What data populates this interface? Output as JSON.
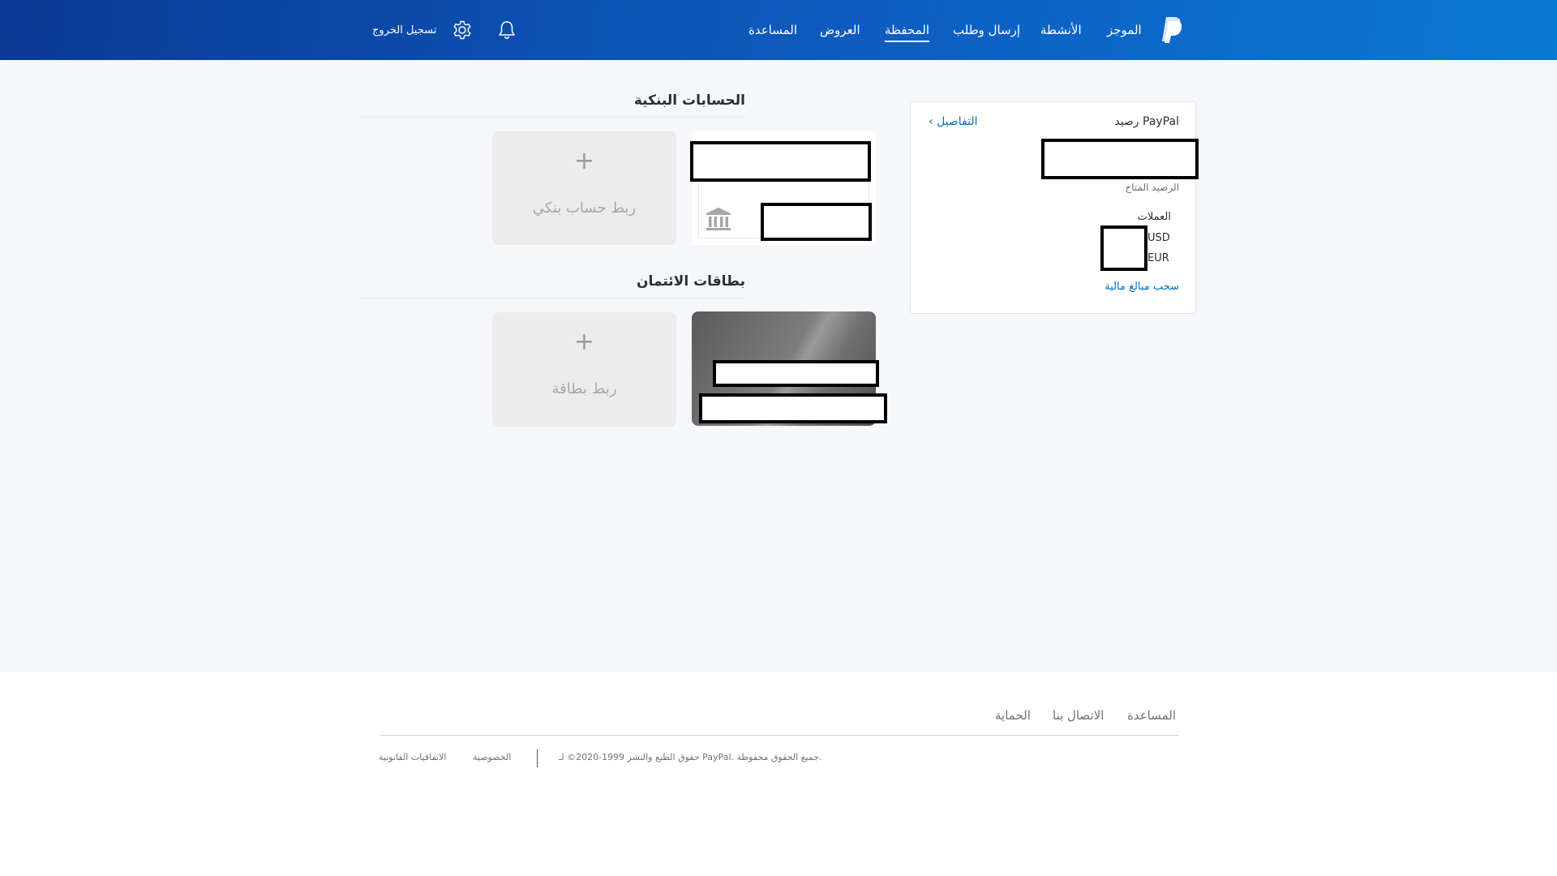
{
  "header": {
    "nav": {
      "summary": "الموجز",
      "activities": "الأنشطة",
      "send_request": "إرسال وطلب",
      "wallet": "المحفظة",
      "offers": "العروض",
      "help": "المساعدة"
    },
    "logout": "تسجيل الخروج",
    "icons": [
      "paypal-logo-icon",
      "bell-icon",
      "gear-icon"
    ]
  },
  "balance": {
    "title": "رصيد PayPal",
    "details_link": "التفاصيل",
    "available_label": "الرصيد المتاح",
    "currencies_label": "العملات",
    "currencies": [
      "USD",
      "EUR"
    ],
    "withdraw_link": "سحب مبالغ مالية"
  },
  "bank_accounts": {
    "title": "الحسابات البنكية",
    "add_plus": "+",
    "add_label": "ربط حساب بنكي",
    "bank_icon": "bank-icon"
  },
  "credit_cards": {
    "title": "بطاقات الائتمان",
    "add_plus": "+",
    "add_label": "ربط بطاقة"
  },
  "footer": {
    "links": {
      "help": "المساعدة",
      "contact": "الاتصال بنا",
      "security": "الحماية"
    },
    "copyright": "حقوق الطبع والنشر 1999-2020© لـ PayPal. جميع الحقوق محفوظة.",
    "privacy": "الخصوصية",
    "legal": "الاتفاقيات القانونية"
  },
  "colors": {
    "header_start": "#0a3a94",
    "header_end": "#0a79d2",
    "link_blue": "#0070ba",
    "page_bg": "#f5f7fa"
  }
}
